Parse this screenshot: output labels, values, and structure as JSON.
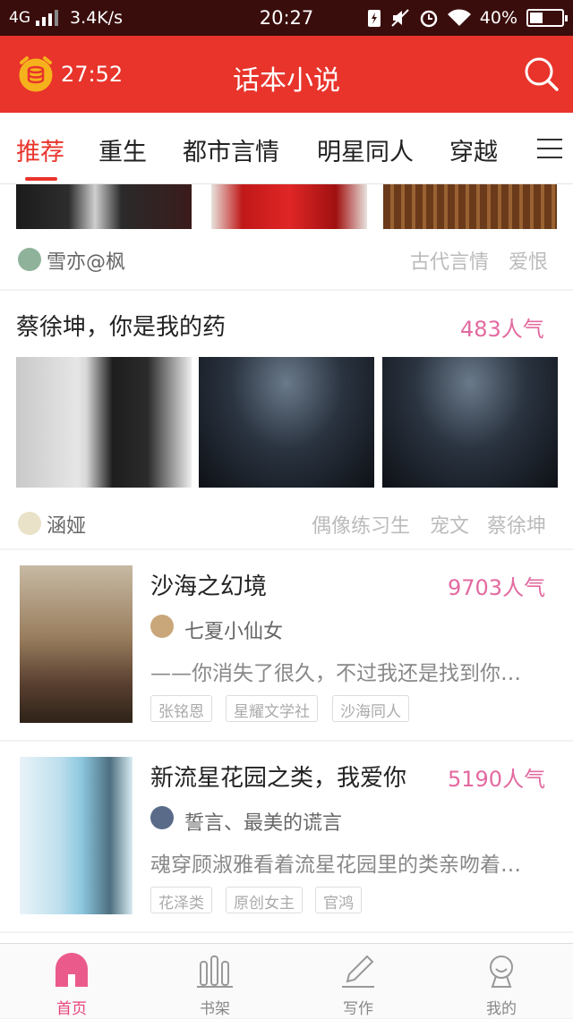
{
  "status": {
    "network": "4G",
    "speed": "3.4K/s",
    "time": "20:27",
    "battery": "40%",
    "battery_level": 0.4
  },
  "header": {
    "timer": "27:52",
    "title": "话本小说",
    "accent_color": "#e8342b"
  },
  "tabs": [
    {
      "label": "推荐",
      "active": true
    },
    {
      "label": "重生"
    },
    {
      "label": "都市言情"
    },
    {
      "label": "明星同人"
    },
    {
      "label": "穿越"
    }
  ],
  "feed": {
    "card1": {
      "author": "雪亦@枫",
      "tags": [
        "古代言情",
        "爱恨"
      ]
    },
    "card2": {
      "title": "蔡徐坤，你是我的药",
      "popularity": "483人气",
      "author": "涵娅",
      "tags": [
        "偶像练习生",
        "宠文",
        "蔡徐坤"
      ]
    },
    "books": [
      {
        "title": "沙海之幻境",
        "popularity": "9703人气",
        "author": "七夏小仙女",
        "desc": "——你消失了很久，不过我还是找到你…",
        "tags": [
          "张铭恩",
          "星耀文学社",
          "沙海同人"
        ]
      },
      {
        "title": "新流星花园之类，我爱你",
        "popularity": "5190人气",
        "author": "誓言、最美的谎言",
        "desc": "魂穿顾淑雅看着流星花园里的类亲吻着…",
        "tags": [
          "花泽类",
          "原创女主",
          "官鸿"
        ]
      }
    ]
  },
  "bottom_nav": [
    {
      "label": "首页",
      "icon": "home-icon",
      "active": true
    },
    {
      "label": "书架",
      "icon": "bookshelf-icon"
    },
    {
      "label": "写作",
      "icon": "pen-icon"
    },
    {
      "label": "我的",
      "icon": "profile-icon"
    }
  ]
}
